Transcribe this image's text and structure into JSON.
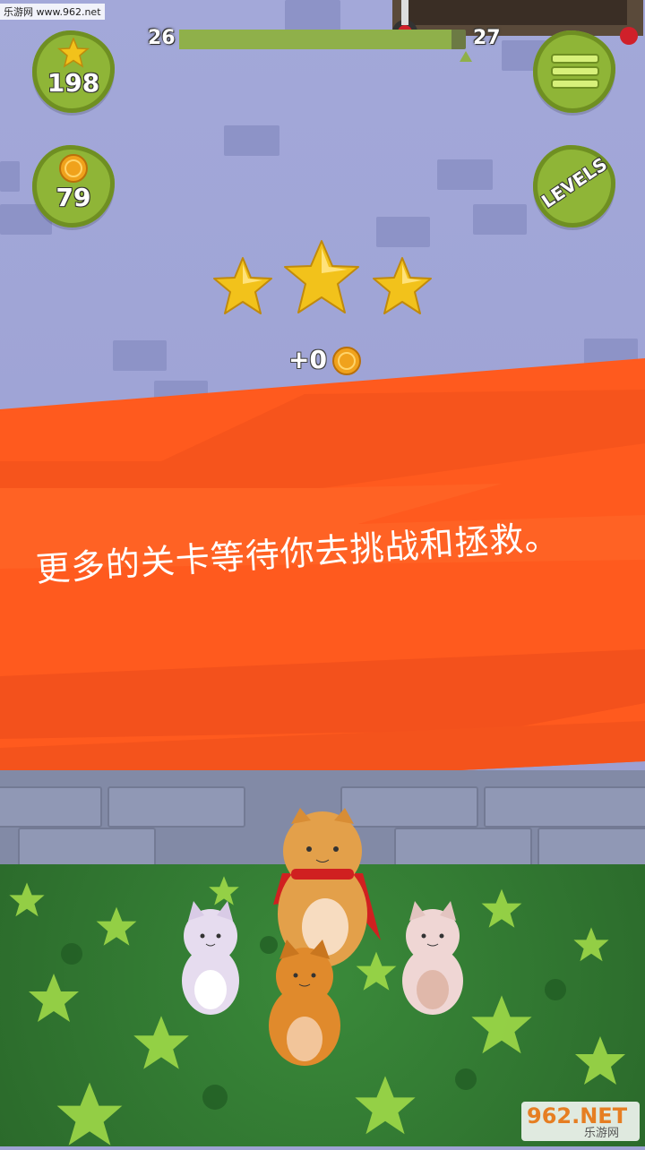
{
  "watermark": {
    "top": "乐游网 www.962.net",
    "logo": "962.NET",
    "sub": "乐游网"
  },
  "progress": {
    "current_level": "26",
    "next_level": "27",
    "fraction": 0.95
  },
  "stats": {
    "stars": "198",
    "coins": "79"
  },
  "buttons": {
    "levels_label": "LEVELS"
  },
  "result": {
    "stars_earned": 3,
    "reward": "+0"
  },
  "banner": {
    "caption": "更多的关卡等待你去挑战和拯救。",
    "color": "#ff5a1e"
  },
  "colors": {
    "button_green": "#8fb537",
    "star_gold": "#f2c21b",
    "coin": "#f0a21c"
  }
}
